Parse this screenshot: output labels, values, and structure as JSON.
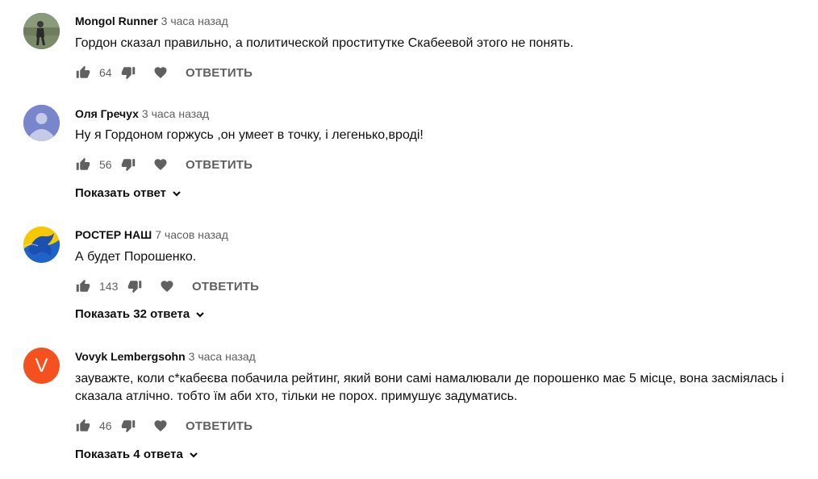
{
  "comments": [
    {
      "author": "Mongol Runner",
      "time": "3 часа назад",
      "text": "Гордон сказал правильно, а политической проститутке Скабеевой этого не понять.",
      "likes": "64",
      "reply_label": "ОТВЕТИТЬ",
      "avatar": "photo-avatar"
    },
    {
      "author": "Оля Гречух",
      "time": "3 часа назад",
      "text": "Ну я Гордоном горжусь ,он умеет в точку, і легенько,вроді!",
      "likes": "56",
      "reply_label": "ОТВЕТИТЬ",
      "show_replies": "Показать ответ",
      "avatar": "default-user-avatar"
    },
    {
      "author": "РОСТЕР НАШ",
      "time": "7 часов назад",
      "text": "А будет Порошенко.",
      "likes": "143",
      "reply_label": "ОТВЕТИТЬ",
      "show_replies": "Показать 32 ответа",
      "avatar": "blue-yellow-flag-avatar"
    },
    {
      "author": "Vovyk Lembergsohn",
      "time": "3 часа назад",
      "text": "зауважте, коли с*кабеєва побачила рейтинг, який вони самі намалювали де порошенко має 5 місце, вона засміялась і сказала атлічно. тобто їм аби хто, тільки не порох. примушує задуматись.",
      "likes": "46",
      "reply_label": "ОТВЕТИТЬ",
      "show_replies": "Показать 4 ответа",
      "avatar": "letter-avatar",
      "avatar_letter": "V"
    }
  ],
  "colors": {
    "text": "#0f0f0f",
    "secondary": "#606060",
    "letter_avatar_bg": "#f4511e",
    "default_avatar_bg": "#7986cb"
  }
}
